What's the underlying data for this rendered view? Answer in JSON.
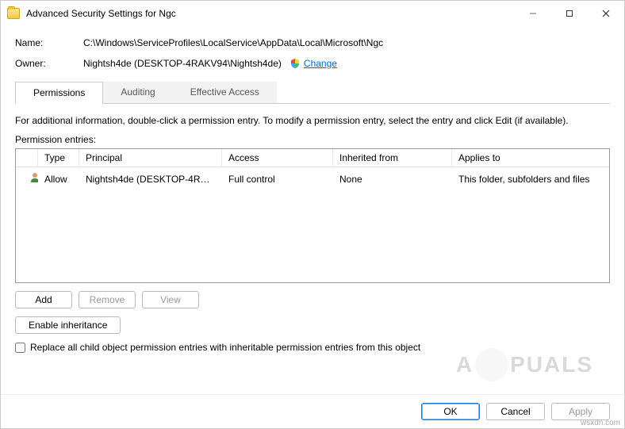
{
  "window": {
    "title": "Advanced Security Settings for Ngc"
  },
  "fields": {
    "name_label": "Name:",
    "name_value": "C:\\Windows\\ServiceProfiles\\LocalService\\AppData\\Local\\Microsoft\\Ngc",
    "owner_label": "Owner:",
    "owner_value": "Nightsh4de (DESKTOP-4RAKV94\\Nightsh4de)",
    "change_link": "Change"
  },
  "tabs": {
    "permissions": "Permissions",
    "auditing": "Auditing",
    "effective": "Effective Access",
    "active": "permissions"
  },
  "info_text": "For additional information, double-click a permission entry. To modify a permission entry, select the entry and click Edit (if available).",
  "entries_label": "Permission entries:",
  "table": {
    "headers": {
      "type": "Type",
      "principal": "Principal",
      "access": "Access",
      "inherited": "Inherited from",
      "applies": "Applies to"
    },
    "rows": [
      {
        "type": "Allow",
        "principal": "Nightsh4de (DESKTOP-4RAKV...",
        "access": "Full control",
        "inherited": "None",
        "applies": "This folder, subfolders and files"
      }
    ]
  },
  "buttons": {
    "add": "Add",
    "remove": "Remove",
    "view": "View",
    "enable_inheritance": "Enable inheritance",
    "ok": "OK",
    "cancel": "Cancel",
    "apply": "Apply"
  },
  "checkbox": {
    "label": "Replace all child object permission entries with inheritable permission entries from this object",
    "checked": false
  },
  "watermark": {
    "text_left": "A",
    "text_right": "PUALS"
  },
  "attribution": "wsxdn.com"
}
